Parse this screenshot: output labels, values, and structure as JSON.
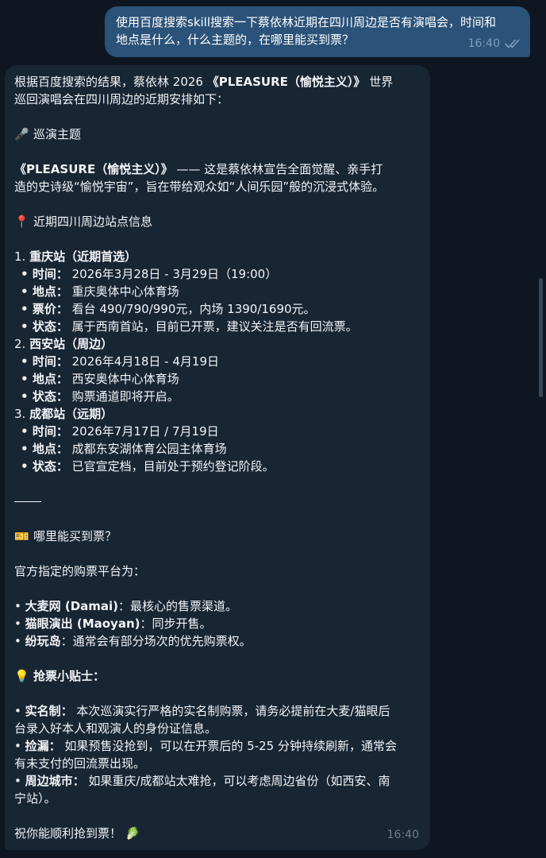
{
  "outgoing": {
    "text_line1": "使用百度搜索skill搜索一下蔡依林近期在四川周边是否有演唱会，时间和",
    "text_line2": "地点是什么，什么主题的，在哪里能买到票？",
    "time": "16:40"
  },
  "incoming": {
    "intro_a": "根据百度搜索的结果，蔡依林 2026 ",
    "intro_tour": "《PLEASURE（愉悦主义）》",
    "intro_b": " 世界",
    "intro_line2": "巡回演唱会在四川周边的近期安排如下：",
    "theme_emoji": "🎤",
    "theme_heading": "巡演主题",
    "theme_tour": "《PLEASURE（愉悦主义）》",
    "theme_desc1": " —— 这是蔡依林宣告全面觉醒、亲手打",
    "theme_desc2": "造的史诗级“愉悦宇宙”，旨在带给观众如“人间乐园”般的沉浸式体验。",
    "stations_emoji": "📍",
    "stations_heading": "近期四川周边站点信息",
    "stations": [
      {
        "num": "1. ",
        "title": "重庆站（近期首选）",
        "rows": [
          {
            "k": "时间：",
            "v": "2026年3月28日 - 3月29日（19:00）"
          },
          {
            "k": "地点：",
            "v": "重庆奥体中心体育场"
          },
          {
            "k": "票价：",
            "v": "看台 490/790/990元，内场 1390/1690元。"
          },
          {
            "k": "状态：",
            "v": "属于西南首站，目前已开票，建议关注是否有回流票。"
          }
        ]
      },
      {
        "num": "2. ",
        "title": "西安站（周边）",
        "rows": [
          {
            "k": "时间：",
            "v": "2026年4月18日 - 4月19日"
          },
          {
            "k": "地点：",
            "v": "西安奥体中心体育场"
          },
          {
            "k": "状态：",
            "v": "购票通道即将开启。"
          }
        ]
      },
      {
        "num": "3. ",
        "title": "成都站（远期）",
        "rows": [
          {
            "k": "时间：",
            "v": "2026年7月17日 / 7月19日"
          },
          {
            "k": "地点：",
            "v": "成都东安湖体育公园主体育场"
          },
          {
            "k": "状态：",
            "v": "已官宣定档，目前处于预约登记阶段。"
          }
        ]
      }
    ],
    "tickets_emoji": "🎫",
    "tickets_heading": "哪里能买到票？",
    "platform_intro": "官方指定的购票平台为：",
    "platforms": [
      {
        "name": "大麦网 (Damai)",
        "desc": "：最核心的售票渠道。"
      },
      {
        "name": "猫眼演出 (Maoyan)",
        "desc": "：同步开售。"
      },
      {
        "name": "纷玩岛",
        "desc": "：通常会有部分场次的优先购票权。"
      }
    ],
    "tips_emoji": "💡",
    "tips_heading": "抢票小贴士：",
    "tips": [
      {
        "k": "实名制：",
        "l1": " 本次巡演实行严格的实名制购票，请务必提前在大麦/猫眼后",
        "l2": "台录入好本人和观演人的身份证信息。"
      },
      {
        "k": "捡漏：",
        "l1": " 如果预售没抢到，可以在开票后的 5-25 分钟持续刷新，通常会",
        "l2": "有未支付的回流票出现。"
      },
      {
        "k": "周边城市：",
        "l1": " 如果重庆/成都站太难抢，可以考虑周边省份（如西安、南",
        "l2": "宁站）。"
      }
    ],
    "closing": "祝你能顺利抢到票！",
    "closing_emoji": "🥬",
    "time": "16:40"
  },
  "colors": {
    "background": "#0e1621",
    "outgoing_bubble": "#2b5278",
    "incoming_bubble": "#182533",
    "read_ticks": "#7e9fc0"
  },
  "icons": {
    "read_status": "double-check-icon"
  }
}
